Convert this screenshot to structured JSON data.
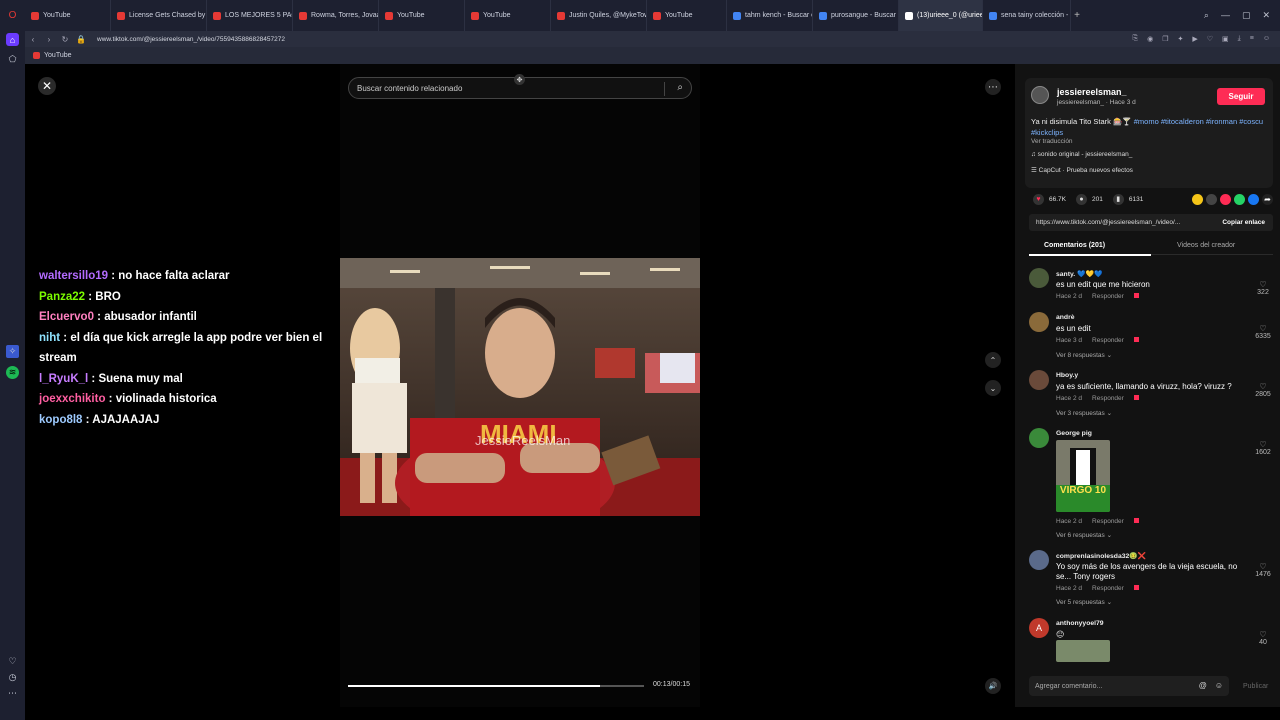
{
  "browser": {
    "tabs": [
      {
        "label": "YouTube",
        "color": "#e53935"
      },
      {
        "label": "License Gets Chased by S...",
        "color": "#e53935"
      },
      {
        "label": "LOS MEJORES 5 PACKS DE",
        "color": "#e53935"
      },
      {
        "label": "Rowma, Torres, Jovaan - ",
        "color": "#e53935"
      },
      {
        "label": "YouTube",
        "color": "#e53935"
      },
      {
        "label": "YouTube",
        "color": "#e53935"
      },
      {
        "label": "Justin Quiles, @MykeTow",
        "color": "#e53935"
      },
      {
        "label": "YouTube",
        "color": "#e53935"
      },
      {
        "label": "tahm kench - Buscar con",
        "color": "#4285f4"
      },
      {
        "label": "purosangue - Buscar con",
        "color": "#4285f4"
      },
      {
        "label": "(13)urieee_0 (@uriee",
        "color": "#ffffff"
      },
      {
        "label": "sena tainy colección - Bu",
        "color": "#4285f4"
      }
    ],
    "active_tab_index": 10,
    "url": "www.tiktok.com/@jessiereelsman_/video/7559435886828457272",
    "bookmark": "YouTube"
  },
  "search": {
    "placeholder": "Buscar contenido relacionado"
  },
  "chat": [
    {
      "user": "waltersillo19",
      "color": "#b36bff",
      "message": "no hace falta aclarar"
    },
    {
      "user": "Panza22",
      "color": "#7cfc00",
      "message": "BRO"
    },
    {
      "user": "Elcuervo0",
      "color": "#ff80c0",
      "message": "abusador infantil"
    },
    {
      "user": "niht",
      "color": "#8fe3ff",
      "message": "el día que kick arregle la app podre ver bien el stream"
    },
    {
      "user": "l_RyuK_l",
      "color": "#c77dff",
      "message": "Suena muy mal"
    },
    {
      "user": "joexxchikito",
      "color": "#ff5fa2",
      "message": "violinada historica"
    },
    {
      "user": "kopo8l8",
      "color": "#9ecbff",
      "message": "AJAJAAJAJ"
    }
  ],
  "video": {
    "watermark": "JessieReelsMan",
    "shirt_text": "MIAMI",
    "time": "00:13/00:15",
    "progress": 0.85
  },
  "creator": {
    "name": "jessiereelsman_",
    "sub": "jessiereelsman_ · Hace 3 d",
    "follow": "Seguir",
    "caption_text": "Ya ni disimula Tito Stark 🎰🍸 ",
    "caption_tags": "#momo #titocalderon #ironman #coscu #kickclips",
    "translate": "Ver traducción",
    "sound": "♫  sonido original - jessiereelsman_",
    "capcut": "☰  CapCut · Prueba nuevos efectos"
  },
  "stats": {
    "likes": "66.7K",
    "comments": "201",
    "saves": "6131"
  },
  "link": {
    "url": "https://www.tiktok.com/@jessiereelsman_/video/...",
    "copy": "Copiar enlace"
  },
  "panel_tabs": {
    "comments": "Comentarios (201)",
    "creator_videos": "Videos del creador"
  },
  "comments": [
    {
      "user": "santy. 💙💛💙",
      "text": "es un edit que me hicieron",
      "meta": "Hace 2 d",
      "reply": "Responder",
      "likes": "322",
      "replies": "",
      "avatar": "#4a5a3a"
    },
    {
      "user": "andrè",
      "text": "es un edit",
      "meta": "Hace 3 d",
      "reply": "Responder",
      "likes": "6335",
      "replies": "Ver 8 respuestas ⌄",
      "avatar": "#8a6a3a"
    },
    {
      "user": "Hboy.y",
      "text": "ya es suficiente, llamando a viruzz, hola? viruzz ?",
      "meta": "Hace 2 d",
      "reply": "Responder",
      "likes": "2805",
      "replies": "Ver 3 respuestas ⌄",
      "avatar": "#6a4a3a"
    },
    {
      "user": "George pig",
      "text": "",
      "meta": "Hace 2 d",
      "reply": "Responder",
      "likes": "1602",
      "replies": "Ver 6 respuestas ⌄",
      "avatar": "#3a8a3a",
      "image_text": "VIRGO 10"
    },
    {
      "user": "comprenlasinolesda32🤢❌",
      "text": "Yo soy más de los avengers de la vieja escuela, no se... Tony rogers",
      "meta": "Hace 2 d",
      "reply": "Responder",
      "likes": "1476",
      "replies": "Ver 5 respuestas ⌄",
      "avatar": "#5a6a8a"
    },
    {
      "user": "anthonyyoel79",
      "text": "😐",
      "meta": "",
      "reply": "",
      "likes": "40",
      "replies": "",
      "avatar": "#c0392b",
      "avatar_letter": "A"
    }
  ],
  "comment_input": {
    "placeholder": "Agregar comentario...",
    "publish": "Publicar"
  }
}
